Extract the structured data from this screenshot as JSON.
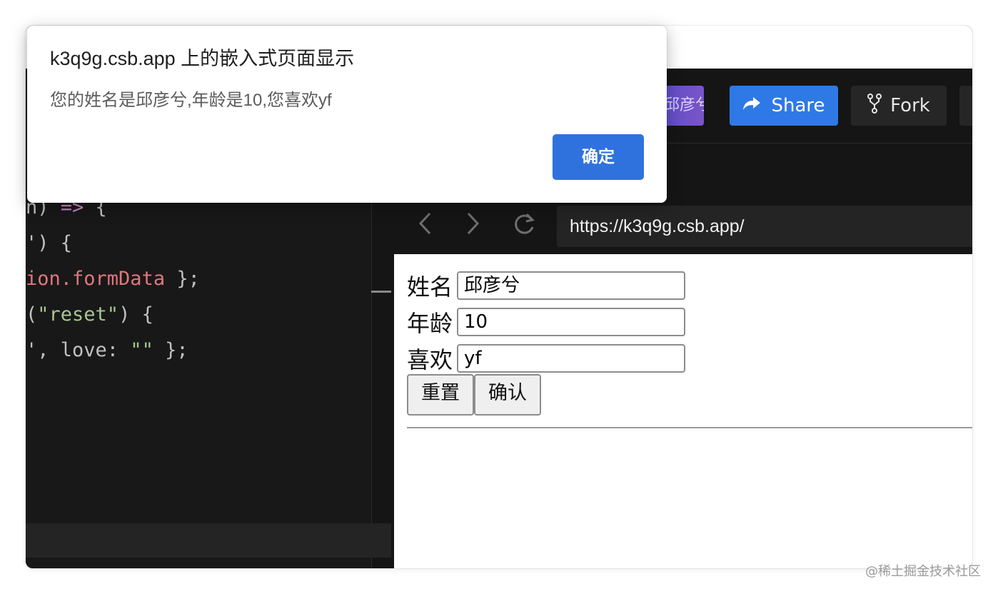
{
  "dialog": {
    "title": "k3q9g.csb.app 上的嵌入式页面显示",
    "message": "您的姓名是邱彦兮,年龄是10,您喜欢yf",
    "ok_label": "确定"
  },
  "header": {
    "user_chip": "邱彦兮",
    "share_label": "Share",
    "fork_label": "Fork"
  },
  "editor": {
    "lines": [
      {
        "a": "n) ",
        "b": "=>",
        "c": " {"
      },
      {
        "a": "') {"
      },
      {
        "a": "ion.",
        "b": "formData",
        "c": " };"
      },
      {
        "a": "(",
        "b": "\"reset\"",
        "c": ") {"
      },
      {
        "a": "', love: ",
        "b": "\"\"",
        "c": " };"
      }
    ]
  },
  "preview": {
    "url": "https://k3q9g.csb.app/",
    "form": {
      "name_label": "姓名",
      "name_value": "邱彦兮",
      "age_label": "年龄",
      "age_value": "10",
      "love_label": "喜欢",
      "love_value": "yf",
      "reset_label": "重置",
      "submit_label": "确认"
    }
  },
  "watermark": "@稀土掘金技术社区",
  "colors": {
    "accent": "#2f79e6",
    "dialog_ok": "#2f72de",
    "editor_bg": "#181818"
  }
}
